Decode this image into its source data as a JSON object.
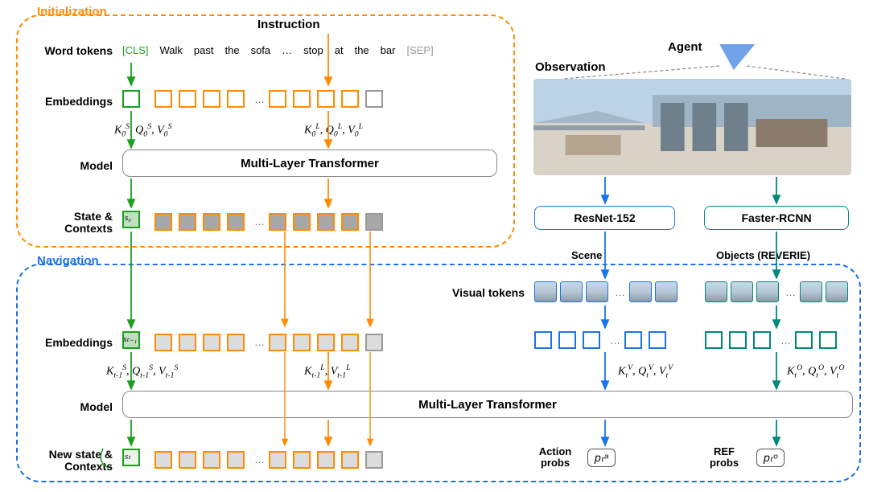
{
  "sections": {
    "initialization": "Initialization",
    "navigation": "Navigation"
  },
  "headers": {
    "instruction": "Instruction",
    "agent": "Agent",
    "observation": "Observation",
    "visual_tokens": "Visual tokens",
    "action_probs": "Action\nprobs",
    "ref_probs": "REF\nprobs"
  },
  "row_labels": {
    "word_tokens": "Word tokens",
    "embeddings": "Embeddings",
    "model": "Model",
    "state_contexts": "State &\nContexts",
    "new_state_contexts": "New state &\nContexts"
  },
  "instruction_tokens": [
    "[CLS]",
    "Walk",
    "past",
    "the",
    "sofa",
    "…",
    "stop",
    "at",
    "the",
    "bar",
    "[SEP]"
  ],
  "modules": {
    "transformer": "Multi-Layer Transformer",
    "resnet": "ResNet-152",
    "faster_rcnn": "Faster-RCNN",
    "scene": "Scene",
    "objects": "Objects (REVERIE)"
  },
  "probs": {
    "action_symbol": "pₜᵃ",
    "ref_symbol": "pₜᵒ"
  },
  "state_symbols": {
    "s0": "s₀",
    "st_minus_1": "sₜ₋₁",
    "st": "sₜ"
  },
  "colors": {
    "orange": "#ff8c00",
    "blue": "#1a73e8",
    "green": "#1ca01c",
    "teal": "#00897b",
    "gray": "#999999"
  }
}
